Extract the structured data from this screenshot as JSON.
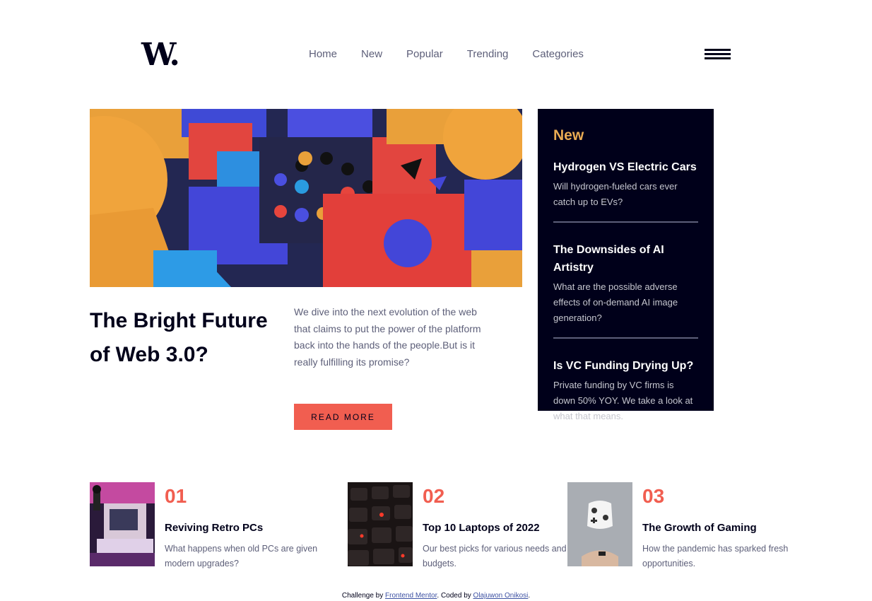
{
  "header": {
    "logo": "W.",
    "nav": [
      "Home",
      "New",
      "Popular",
      "Trending",
      "Categories"
    ]
  },
  "hero": {
    "title": "The Bright Future of Web 3.0?",
    "text": "We dive into the next evolution of the web that claims to put the power of the platform back into the hands of the people.But is it really fulfilling its promise?",
    "button": "READ MORE"
  },
  "new_panel": {
    "heading": "New",
    "items": [
      {
        "title": "Hydrogen VS Electric Cars",
        "text": "Will hydrogen-fueled cars ever catch up to EVs?"
      },
      {
        "title": "The Downsides of AI Artistry",
        "text": "What are the possible adverse effects of on-demand AI image generation?"
      },
      {
        "title": "Is VC Funding Drying Up?",
        "text": "Private funding by VC firms is down 50% YOY. We take a look at what that means."
      }
    ]
  },
  "ranked": [
    {
      "num": "01",
      "title": "Reviving Retro PCs",
      "text": "What happens when old PCs are given modern upgrades?"
    },
    {
      "num": "02",
      "title": "Top 10 Laptops of 2022",
      "text": "Our best picks for various needs and budgets."
    },
    {
      "num": "03",
      "title": "The Growth of Gaming",
      "text": "How the pandemic has sparked fresh opportunities."
    }
  ],
  "footer": {
    "prefix": "Challenge by",
    "link1": "Frontend Mentor",
    "middle": ". Coded by",
    "link2": "Olajuwon Onikosi",
    "suffix": "."
  },
  "colors": {
    "dark_navy": "#00001a",
    "soft_red": "#f15e50",
    "soft_orange": "#e9ab53",
    "grayish_blue": "#5d5f79"
  }
}
